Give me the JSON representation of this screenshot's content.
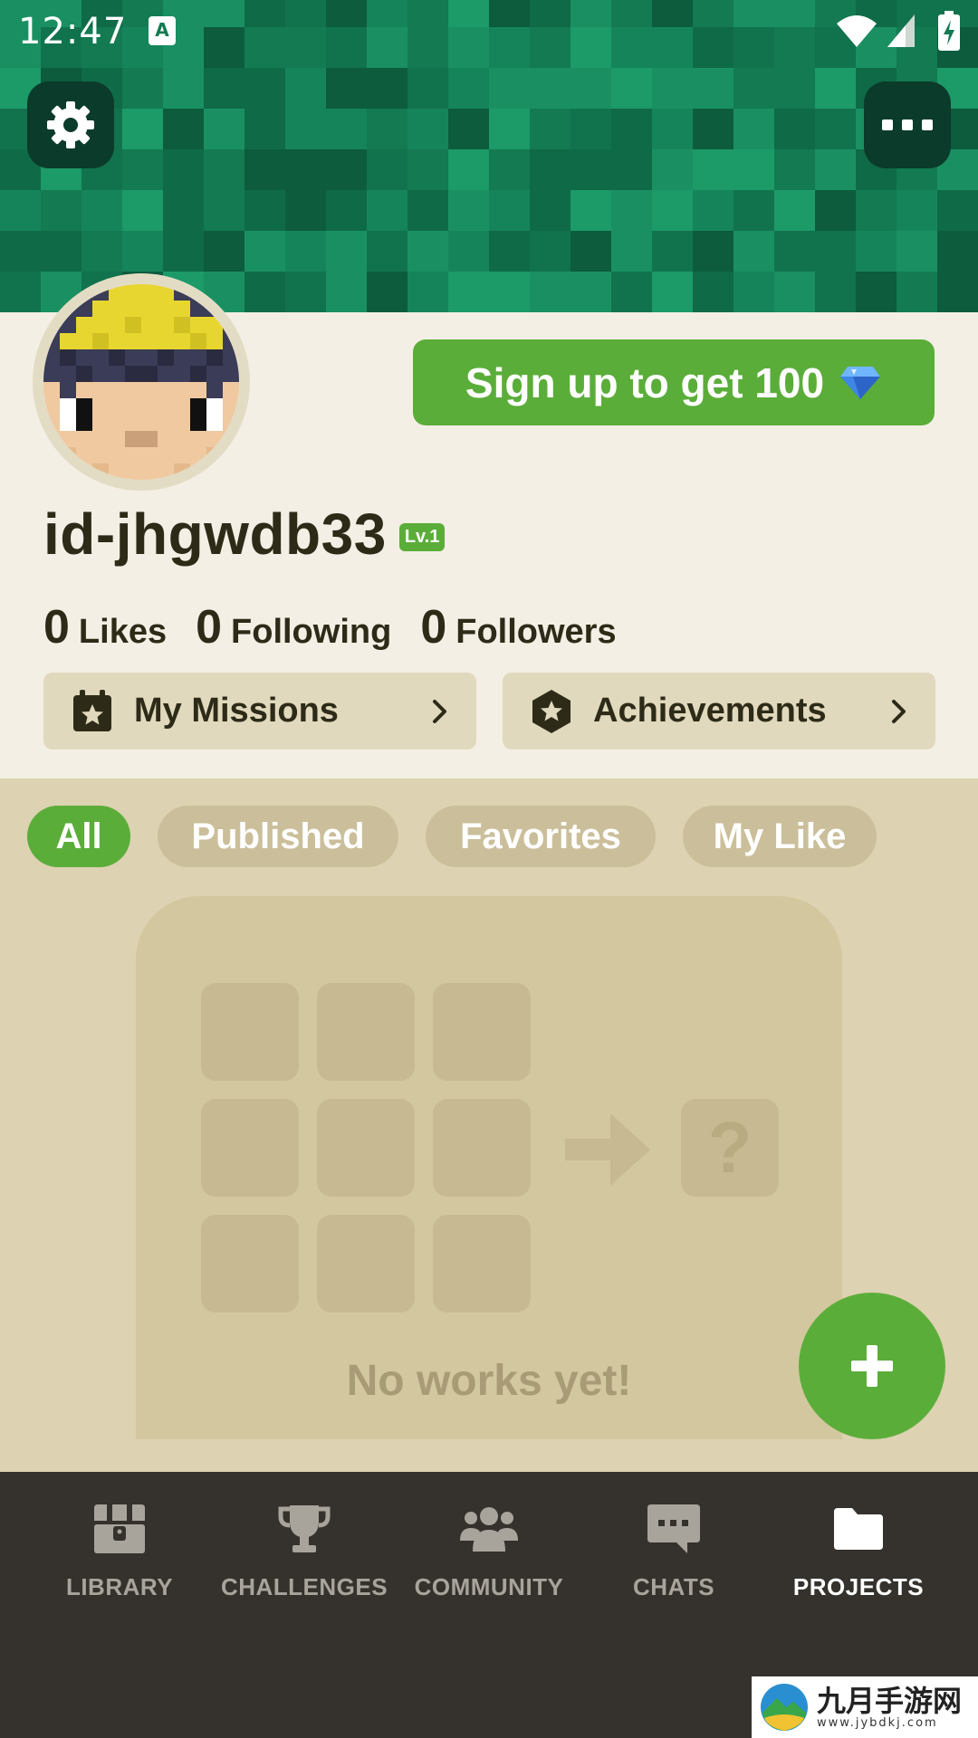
{
  "status_bar": {
    "time": "12:47",
    "notification_icon": "A"
  },
  "header": {
    "settings_icon": "gear-icon",
    "more_icon": "more-dots-icon"
  },
  "profile": {
    "signup_label": "Sign up to get 100",
    "username": "id-jhgwdb33",
    "level": "Lv.1",
    "stats": [
      {
        "value": "0",
        "label": "Likes"
      },
      {
        "value": "0",
        "label": "Following"
      },
      {
        "value": "0",
        "label": "Followers"
      }
    ],
    "missions_label": "My Missions",
    "achievements_label": "Achievements"
  },
  "tabs": [
    {
      "label": "All",
      "active": true
    },
    {
      "label": "Published",
      "active": false
    },
    {
      "label": "Favorites",
      "active": false
    },
    {
      "label": "My Like",
      "active": false
    }
  ],
  "empty_state": {
    "placeholder_symbol": "?",
    "message": "No works yet!"
  },
  "fab_icon": "plus-icon",
  "bottom_nav": [
    {
      "label": "LIBRARY",
      "icon": "library-chest-icon",
      "active": false
    },
    {
      "label": "CHALLENGES",
      "icon": "trophy-icon",
      "active": false
    },
    {
      "label": "COMMUNITY",
      "icon": "people-icon",
      "active": false
    },
    {
      "label": "CHATS",
      "icon": "chat-bubble-icon",
      "active": false
    },
    {
      "label": "PROJECTS",
      "icon": "folder-icon",
      "active": true
    }
  ],
  "watermark": {
    "title": "九月手游网",
    "subtitle": "www.jybdkj.com"
  },
  "colors": {
    "accent_green": "#5bad3a",
    "header_green": "#137a52",
    "profile_bg": "#f3efe4",
    "content_bg": "#ddd2b1",
    "nav_bg": "#35322d"
  }
}
